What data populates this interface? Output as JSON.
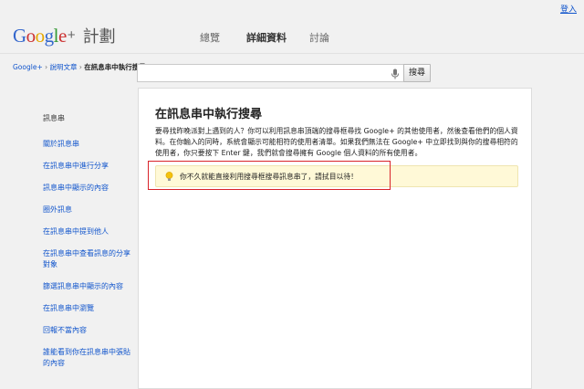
{
  "topbar": {
    "login_label": "登入"
  },
  "logo": {
    "google": [
      "G",
      "o",
      "o",
      "g",
      "l",
      "e"
    ],
    "google_colors": [
      "#3366cc",
      "#cc3333",
      "#e6a800",
      "#3366cc",
      "#339933",
      "#cc3333"
    ],
    "plus": "+",
    "project": "計劃"
  },
  "nav": {
    "items": [
      "總覽",
      "詳細資料",
      "討論"
    ],
    "active_index": 1
  },
  "breadcrumb": {
    "home": "Google+",
    "sep": "›",
    "help": "說明文章",
    "current": "在訊息串中執行搜尋"
  },
  "search": {
    "value": "",
    "placeholder": "",
    "button_label": "搜尋"
  },
  "sidebar": {
    "title": "訊息串",
    "items": [
      "關於訊息串",
      "在訊息串中進行分享",
      "訊息串中顯示的內容",
      "圈外訊息",
      "在訊息串中提到他人",
      "在訊息串中查看訊息的分享對象",
      "篩選訊息串中顯示的內容",
      "在訊息串中瀏覽",
      "回報不當內容",
      "誰能看到你在訊息串中張貼的內容"
    ]
  },
  "article": {
    "title": "在訊息串中執行搜尋",
    "body": "要尋找昨晚派對上遇到的人？你可以利用訊息串頂端的搜尋框尋找 Google+ 的其他使用者，然後查看他們的個人資料。在你輸入的同時，系統會顯示可能相符的使用者清單。如果我們無法在 Google+ 中立即找到與你的搜尋相符的使用者，你只要按下 Enter 鍵，我們就會搜尋擁有 Google 個人資料的所有使用者。",
    "notice": "你不久就能直接利用搜尋框搜尋訊息串了，請拭目以待！"
  },
  "colors": {
    "link": "#1155cc",
    "highlight_border": "#d9232a",
    "notice_bg": "#fff9d7"
  },
  "icons": {
    "mic": "microphone-icon",
    "bulb": "lightbulb-icon"
  }
}
